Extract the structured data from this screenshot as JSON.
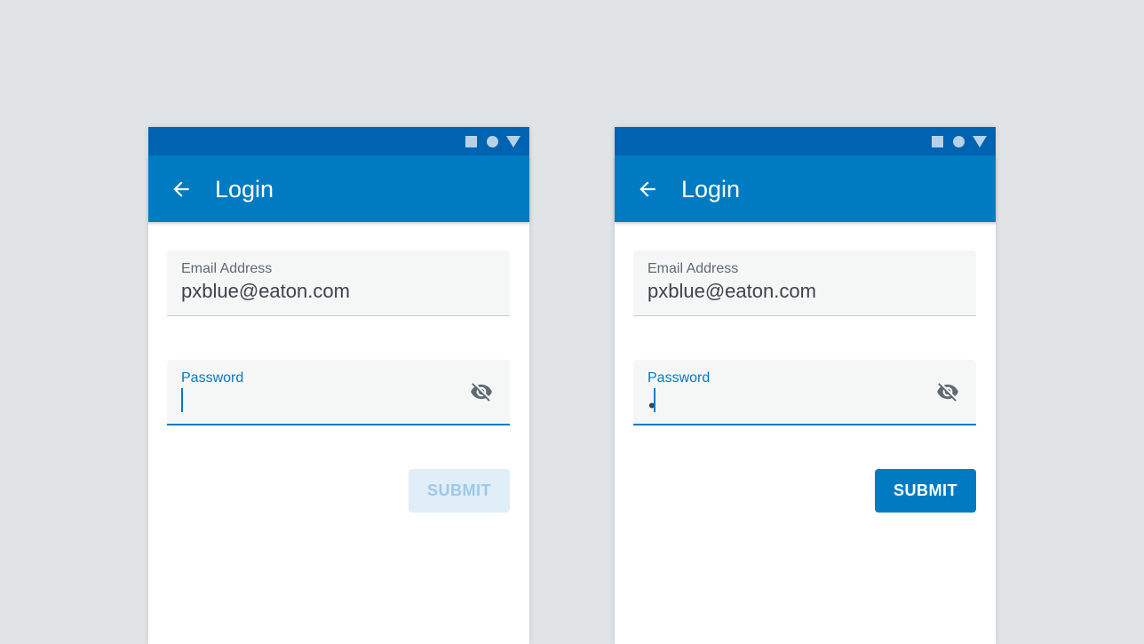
{
  "colors": {
    "background": "#e0e4e6",
    "status_bar": "#0063b1",
    "app_bar": "#007bc1",
    "accent": "#007bc1",
    "field_bg": "#f5f6f6",
    "submit_disabled_bg": "#e0eef8",
    "submit_disabled_text": "#9ec9e6"
  },
  "screens": [
    {
      "status_icons": [
        "square-icon",
        "circle-icon",
        "triangle-icon"
      ],
      "app_bar": {
        "back_icon": "arrow-back-icon",
        "title": "Login"
      },
      "email": {
        "label": "Email Address",
        "value": "pxblue@eaton.com"
      },
      "password": {
        "label": "Password",
        "value": "",
        "visibility_icon": "eye-off-icon",
        "focused": true
      },
      "submit": {
        "label": "SUBMIT",
        "enabled": false
      }
    },
    {
      "status_icons": [
        "square-icon",
        "circle-icon",
        "triangle-icon"
      ],
      "app_bar": {
        "back_icon": "arrow-back-icon",
        "title": "Login"
      },
      "email": {
        "label": "Email Address",
        "value": "pxblue@eaton.com"
      },
      "password": {
        "label": "Password",
        "value": "•",
        "visibility_icon": "eye-off-icon",
        "focused": true
      },
      "submit": {
        "label": "SUBMIT",
        "enabled": true
      }
    }
  ]
}
